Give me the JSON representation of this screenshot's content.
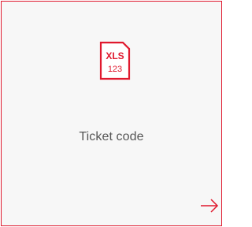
{
  "card": {
    "label": "Ticket code",
    "accent_color": "#e0192e",
    "icon": {
      "name": "xls-file-icon",
      "line1": "XLS",
      "line2": "123"
    },
    "action_icon": "arrow-right-icon"
  }
}
